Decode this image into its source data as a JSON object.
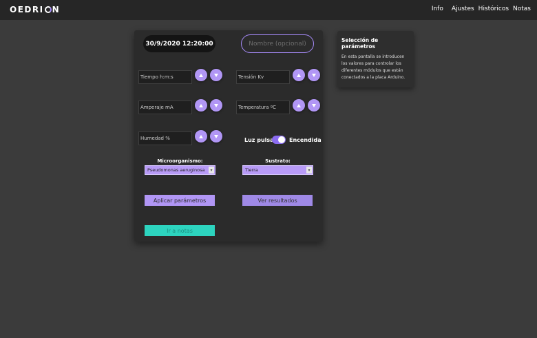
{
  "app": {
    "logo_text_a": "OEDRI",
    "logo_text_b": "N"
  },
  "nav": {
    "items": [
      "Info",
      "Ajustes",
      "Históricos",
      "Notas"
    ]
  },
  "header": {
    "datetime": "30/9/2020 12:20:00",
    "name_placeholder": "Nombre (opcional)"
  },
  "params": {
    "tiempo": "Tiempo h:m:s",
    "tension": "Tensión Kv",
    "amperaje": "Amperaje mA",
    "temperatura": "Temperatura ºC",
    "humedad": "Humedad %"
  },
  "controls": {
    "up_icon": "triangle-up",
    "down_icon": "triangle-down"
  },
  "light": {
    "label": "Luz pulsada",
    "state_label": "Encendida",
    "on": true
  },
  "microorganismo": {
    "label": "Microorganismo:",
    "selected": "Pseudomonas aeruginosa"
  },
  "sustrato": {
    "label": "Sustrato:",
    "selected": "Tierra"
  },
  "buttons": {
    "apply": "Aplicar parámetros",
    "results": "Ver resultados",
    "notes": "Ir a notas"
  },
  "info": {
    "title": "Selección de parámetros",
    "body": "En esta pantalla se introducen los valores para controlar los diferentes módulos que están conectados a la placa Arduino."
  },
  "colors": {
    "accent": "#b196f5",
    "teal": "#2dd4bf",
    "background": "#3b3b3b",
    "card": "#2b2b2b"
  }
}
